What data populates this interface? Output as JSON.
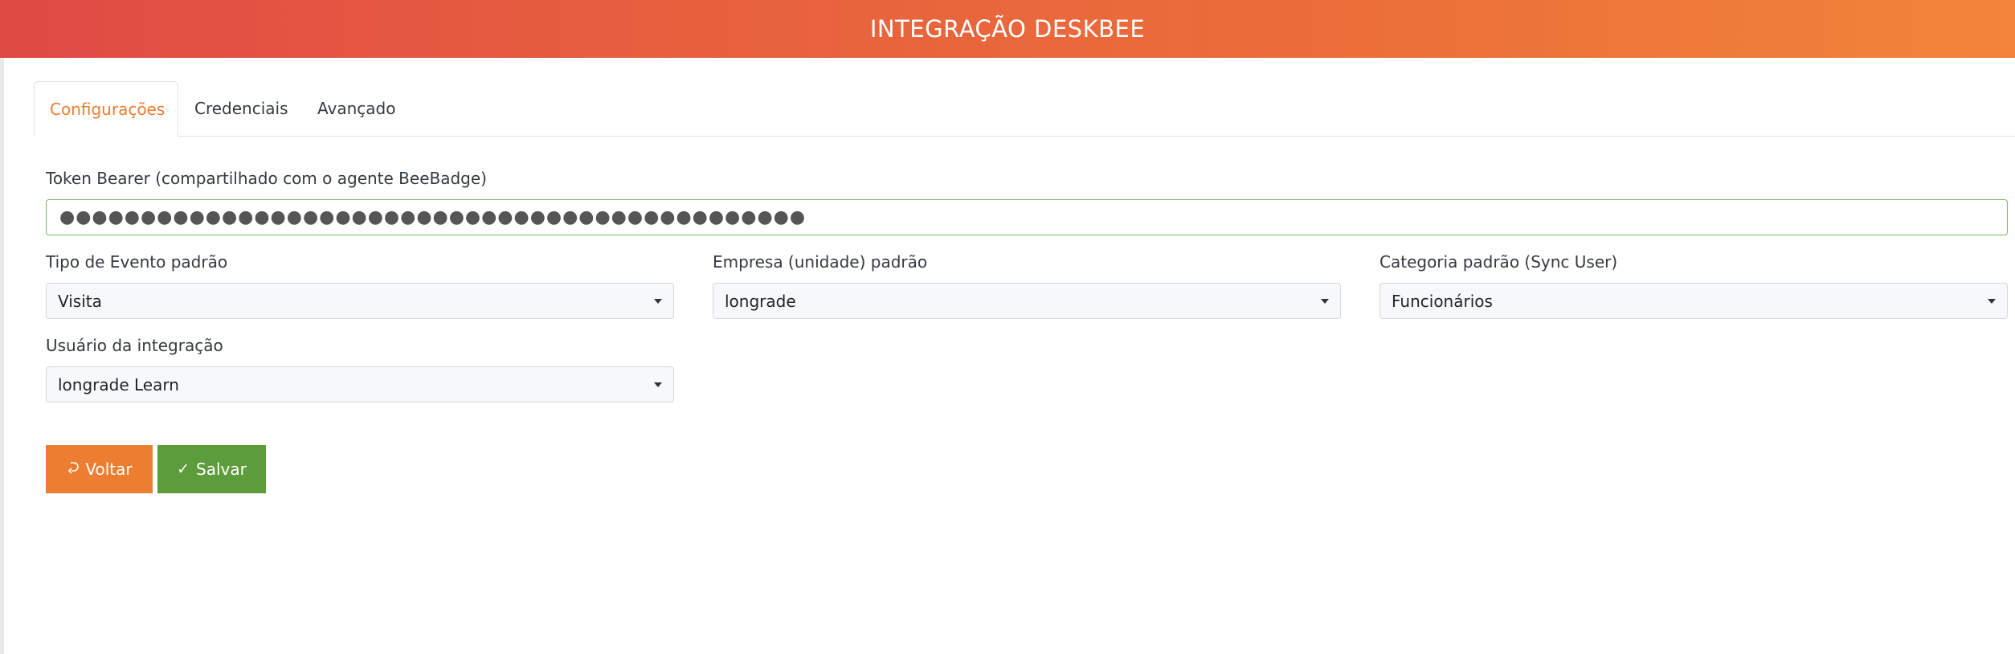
{
  "header": {
    "title": "INTEGRAÇÃO DESKBEE"
  },
  "tabs": [
    {
      "label": "Configurações",
      "active": true
    },
    {
      "label": "Credenciais",
      "active": false
    },
    {
      "label": "Avançado",
      "active": false
    }
  ],
  "form": {
    "token": {
      "label": "Token Bearer (compartilhado com o agente BeeBadge)",
      "value": "●●●●●●●●●●●●●●●●●●●●●●●●●●●●●●●●●●●●●●●●●●●●●●"
    },
    "event_type": {
      "label": "Tipo de Evento padrão",
      "value": "Visita"
    },
    "company": {
      "label": "Empresa (unidade) padrão",
      "value": "longrade"
    },
    "category": {
      "label": "Categoria padrão (Sync User)",
      "value": "Funcionários"
    },
    "integration_user": {
      "label": "Usuário da integração",
      "value": "longrade Learn"
    }
  },
  "actions": {
    "back_label": "Voltar",
    "back_icon": "undo-icon",
    "save_label": "Salvar",
    "save_icon": "check-icon"
  },
  "colors": {
    "accent": "#ed7d31",
    "header_start": "#e04a45",
    "header_end": "#f2853a",
    "save": "#5d9c3b",
    "input_focus_border": "#6fbf5b"
  }
}
